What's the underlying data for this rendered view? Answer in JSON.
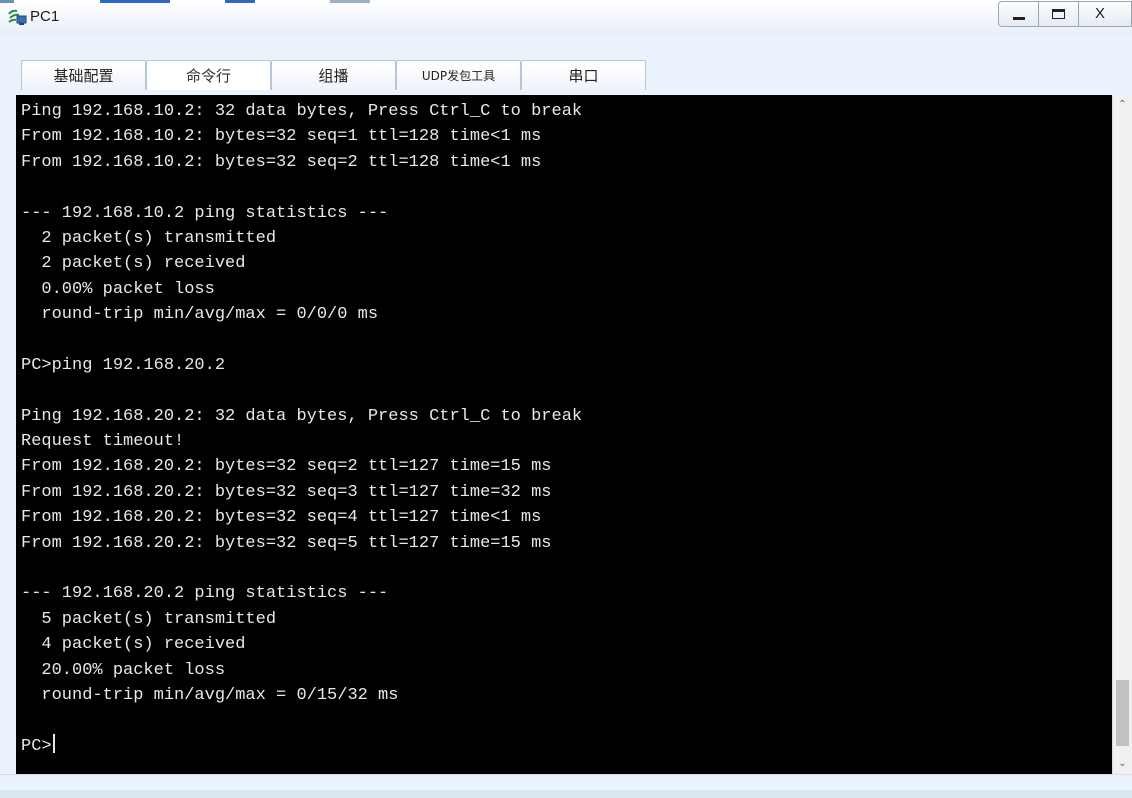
{
  "window": {
    "title": "PC1",
    "controls": {
      "close_label": "X"
    }
  },
  "tabs": [
    {
      "label": "基础配置",
      "active": false
    },
    {
      "label": "命令行",
      "active": true
    },
    {
      "label": "组播",
      "active": false
    },
    {
      "label": "UDP发包工具",
      "active": false
    },
    {
      "label": "串口",
      "active": false
    }
  ],
  "terminal": {
    "lines": [
      "Ping 192.168.10.2: 32 data bytes, Press Ctrl_C to break",
      "From 192.168.10.2: bytes=32 seq=1 ttl=128 time<1 ms",
      "From 192.168.10.2: bytes=32 seq=2 ttl=128 time<1 ms",
      "",
      "--- 192.168.10.2 ping statistics ---",
      "  2 packet(s) transmitted",
      "  2 packet(s) received",
      "  0.00% packet loss",
      "  round-trip min/avg/max = 0/0/0 ms",
      "",
      "PC>ping 192.168.20.2",
      "",
      "Ping 192.168.20.2: 32 data bytes, Press Ctrl_C to break",
      "Request timeout!",
      "From 192.168.20.2: bytes=32 seq=2 ttl=127 time=15 ms",
      "From 192.168.20.2: bytes=32 seq=3 ttl=127 time=32 ms",
      "From 192.168.20.2: bytes=32 seq=4 ttl=127 time<1 ms",
      "From 192.168.20.2: bytes=32 seq=5 ttl=127 time=15 ms",
      "",
      "--- 192.168.20.2 ping statistics ---",
      "  5 packet(s) transmitted",
      "  4 packet(s) received",
      "  20.00% packet loss",
      "  round-trip min/avg/max = 0/15/32 ms",
      ""
    ],
    "prompt": "PC>"
  },
  "colors": {
    "terminal_bg": "#000000",
    "terminal_fg": "#e8e8e8",
    "window_bg": "#eaf2fb"
  }
}
